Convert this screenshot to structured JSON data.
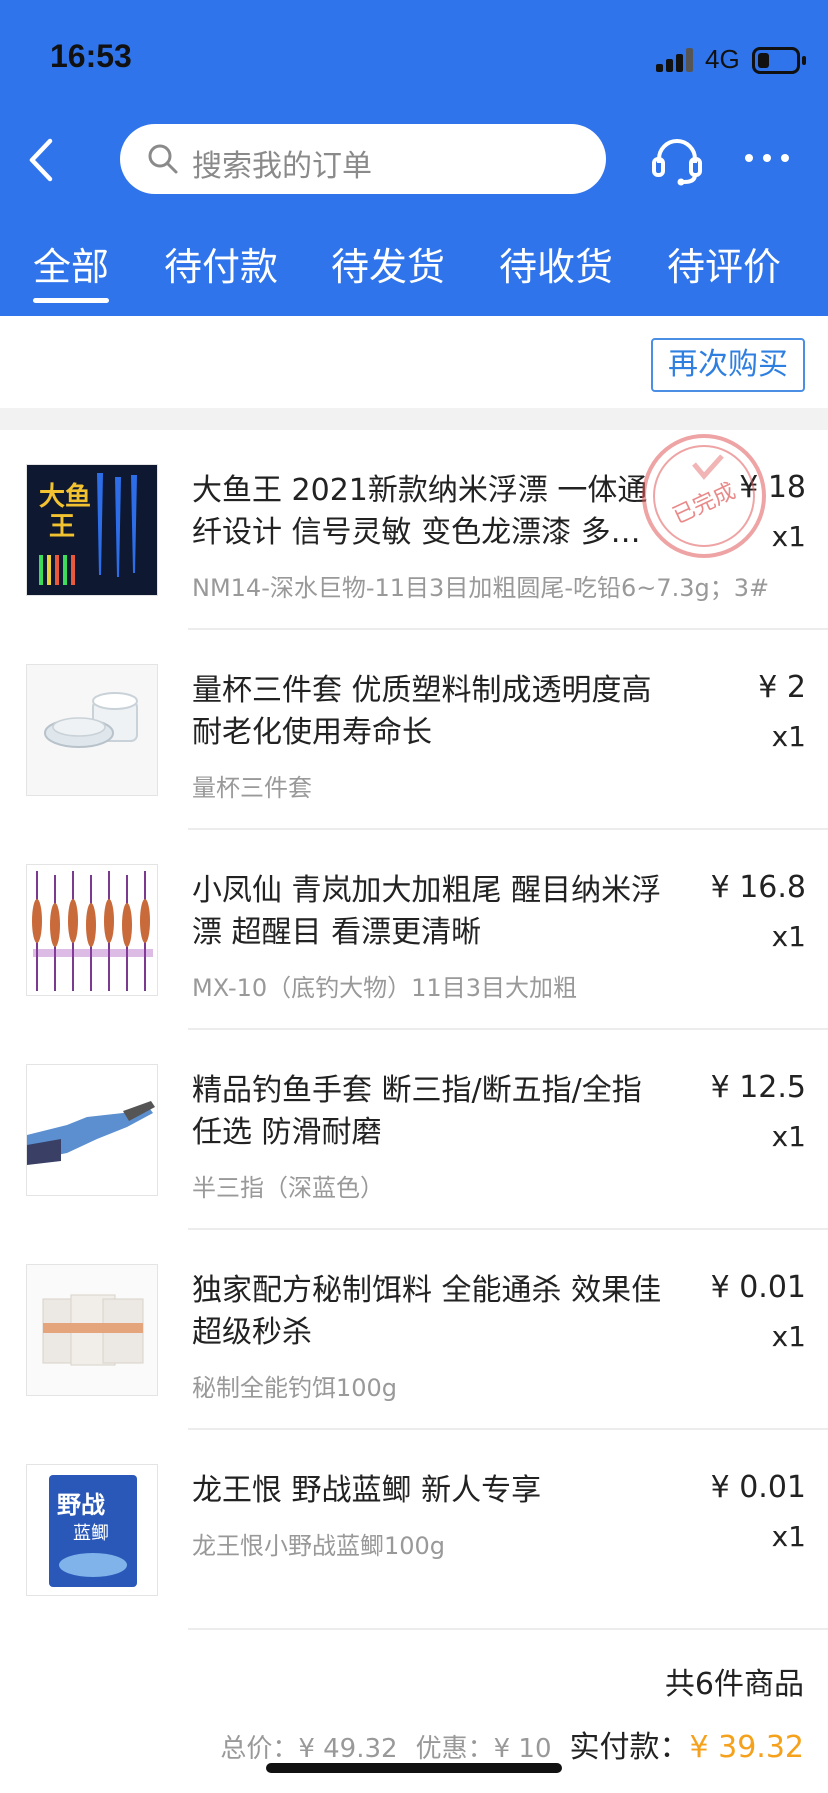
{
  "status_bar": {
    "time": "16:53",
    "network": "4G"
  },
  "search": {
    "placeholder": "搜索我的订单"
  },
  "tabs": [
    {
      "label": "全部",
      "active": true
    },
    {
      "label": "待付款"
    },
    {
      "label": "待发货"
    },
    {
      "label": "待收货"
    },
    {
      "label": "待评价"
    }
  ],
  "order": {
    "rebuy_label": "再次购买",
    "status_stamp": "已完成",
    "items": [
      {
        "title": "大鱼王 2021新款纳米浮漂 一体通纤设计 信号灵敏 变色龙漂漆 多…",
        "sku": "NM14-深水巨物-11目3目加粗圆尾-吃铅6~7.3g；3#",
        "price": "¥ 18",
        "qty": "x1",
        "thumb_text": "大鱼王"
      },
      {
        "title": "量杯三件套 优质塑料制成透明度高 耐老化使用寿命长",
        "sku": "量杯三件套",
        "price": "¥ 2",
        "qty": "x1"
      },
      {
        "title": "小凤仙 青岚加大加粗尾 醒目纳米浮漂 超醒目 看漂更清晰",
        "sku": "MX-10（底钓大物）11目3目大加粗",
        "price": "¥ 16.8",
        "qty": "x1"
      },
      {
        "title": "精品钓鱼手套 断三指/断五指/全指任选 防滑耐磨",
        "sku": "半三指（深蓝色）",
        "price": "¥ 12.5",
        "qty": "x1"
      },
      {
        "title": "独家配方秘制饵料 全能通杀 效果佳 超级秒杀",
        "sku": "秘制全能钓饵100g",
        "price": "¥ 0.01",
        "qty": "x1"
      },
      {
        "title": "龙王恨 野战蓝鲫  新人专享",
        "sku": "龙王恨小野战蓝鲫100g",
        "price": "¥ 0.01",
        "qty": "x1",
        "thumb_text": "野战蓝鲫"
      }
    ],
    "count_text": "共6件商品",
    "total_label": "总价：",
    "total_value": "¥ 49.32",
    "discount_label": "优惠：",
    "discount_value": "¥ 10",
    "paid_label": "实付款：",
    "paid_value": "¥ 39.32"
  },
  "colors": {
    "header_bg": "#2f74eb",
    "accent_link": "#2f7fe0",
    "pay_amount": "#f5a11c",
    "stamp": "#e05a5a"
  },
  "icons": [
    "back-icon",
    "search-icon",
    "headset-icon",
    "more-icon",
    "signal-icon",
    "battery-icon"
  ]
}
